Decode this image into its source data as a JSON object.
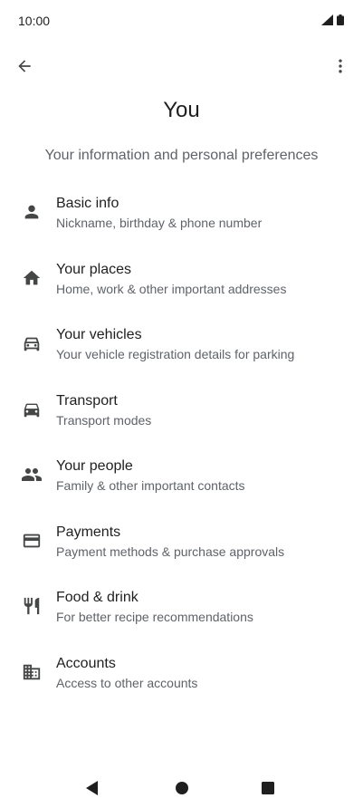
{
  "status": {
    "time": "10:00"
  },
  "header": {
    "title": "You",
    "subtitle": "Your information and personal preferences"
  },
  "items": [
    {
      "title": "Basic info",
      "desc": "Nickname, birthday & phone number",
      "icon": "person-icon"
    },
    {
      "title": "Your places",
      "desc": "Home, work & other important addresses",
      "icon": "home-icon"
    },
    {
      "title": "Your vehicles",
      "desc": "Your vehicle registration details for parking",
      "icon": "car-icon"
    },
    {
      "title": "Transport",
      "desc": "Transport modes",
      "icon": "car-filled-icon"
    },
    {
      "title": "Your people",
      "desc": "Family & other important contacts",
      "icon": "people-icon"
    },
    {
      "title": "Payments",
      "desc": "Payment methods & purchase approvals",
      "icon": "credit-card-icon"
    },
    {
      "title": "Food & drink",
      "desc": "For better recipe recommendations",
      "icon": "fork-knife-icon"
    },
    {
      "title": "Accounts",
      "desc": "Access to other accounts",
      "icon": "building-icon"
    }
  ],
  "colors": {
    "text": "#1f1f1f",
    "secondary": "#5f6368",
    "icon": "#444746"
  }
}
